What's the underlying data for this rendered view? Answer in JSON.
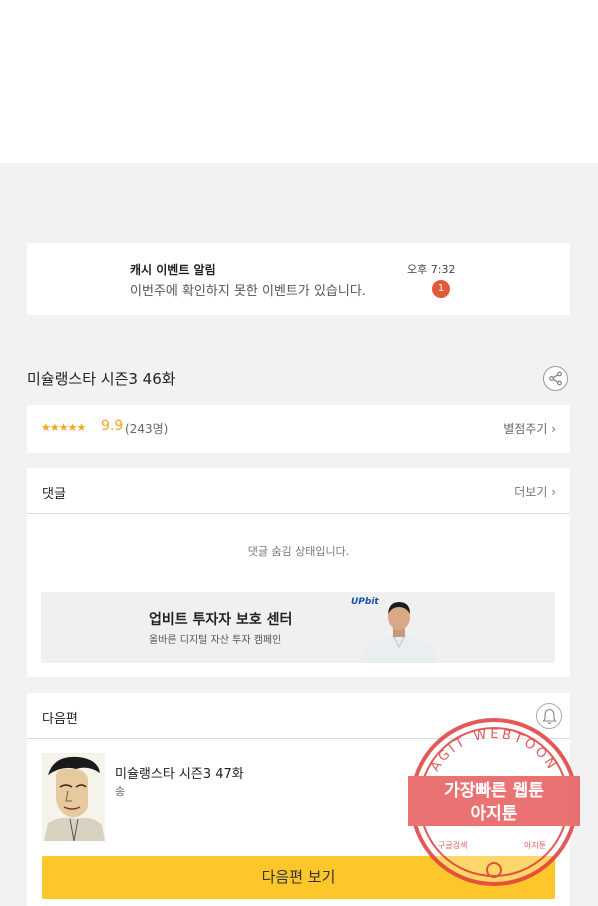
{
  "notification": {
    "title": "캐시 이벤트 알림",
    "message": "이번주에 확인하지 못한 이벤트가 있습니다.",
    "time": "오후 7:32",
    "badge": "1"
  },
  "episode": {
    "title": "미슐랭스타 시즌3 46화",
    "share_icon": "share-icon"
  },
  "rating": {
    "stars": "★★★★★",
    "score": "9.9",
    "count": "(243명)",
    "rate_label": "별점주기 ›"
  },
  "comments": {
    "label": "댓글",
    "more_label": "더보기 ›",
    "hidden_message": "댓글 숨김 상태입니다."
  },
  "ad": {
    "title": "업비트 투자자 보호 센터",
    "subtitle": "올바른 디지털 자산 투자 캠페인",
    "logo": "UPbit"
  },
  "next": {
    "label": "다음편",
    "bell_icon": "bell-icon",
    "episode_title": "미슐랭스타 시즌3 47화",
    "episode_sub": "송",
    "button_label": "다음편 보기"
  },
  "watermark": {
    "ring_text": "AGIT WEBTOON",
    "line1": "가장빠른 웹툰",
    "line2": "아지툰",
    "small_left": "구글검색",
    "small_right": "아지툰"
  },
  "colors": {
    "accent_yellow": "#fdc62a",
    "star_orange": "#f5a623",
    "badge_red": "#e05a3a",
    "watermark_red": "#e03c3c"
  }
}
